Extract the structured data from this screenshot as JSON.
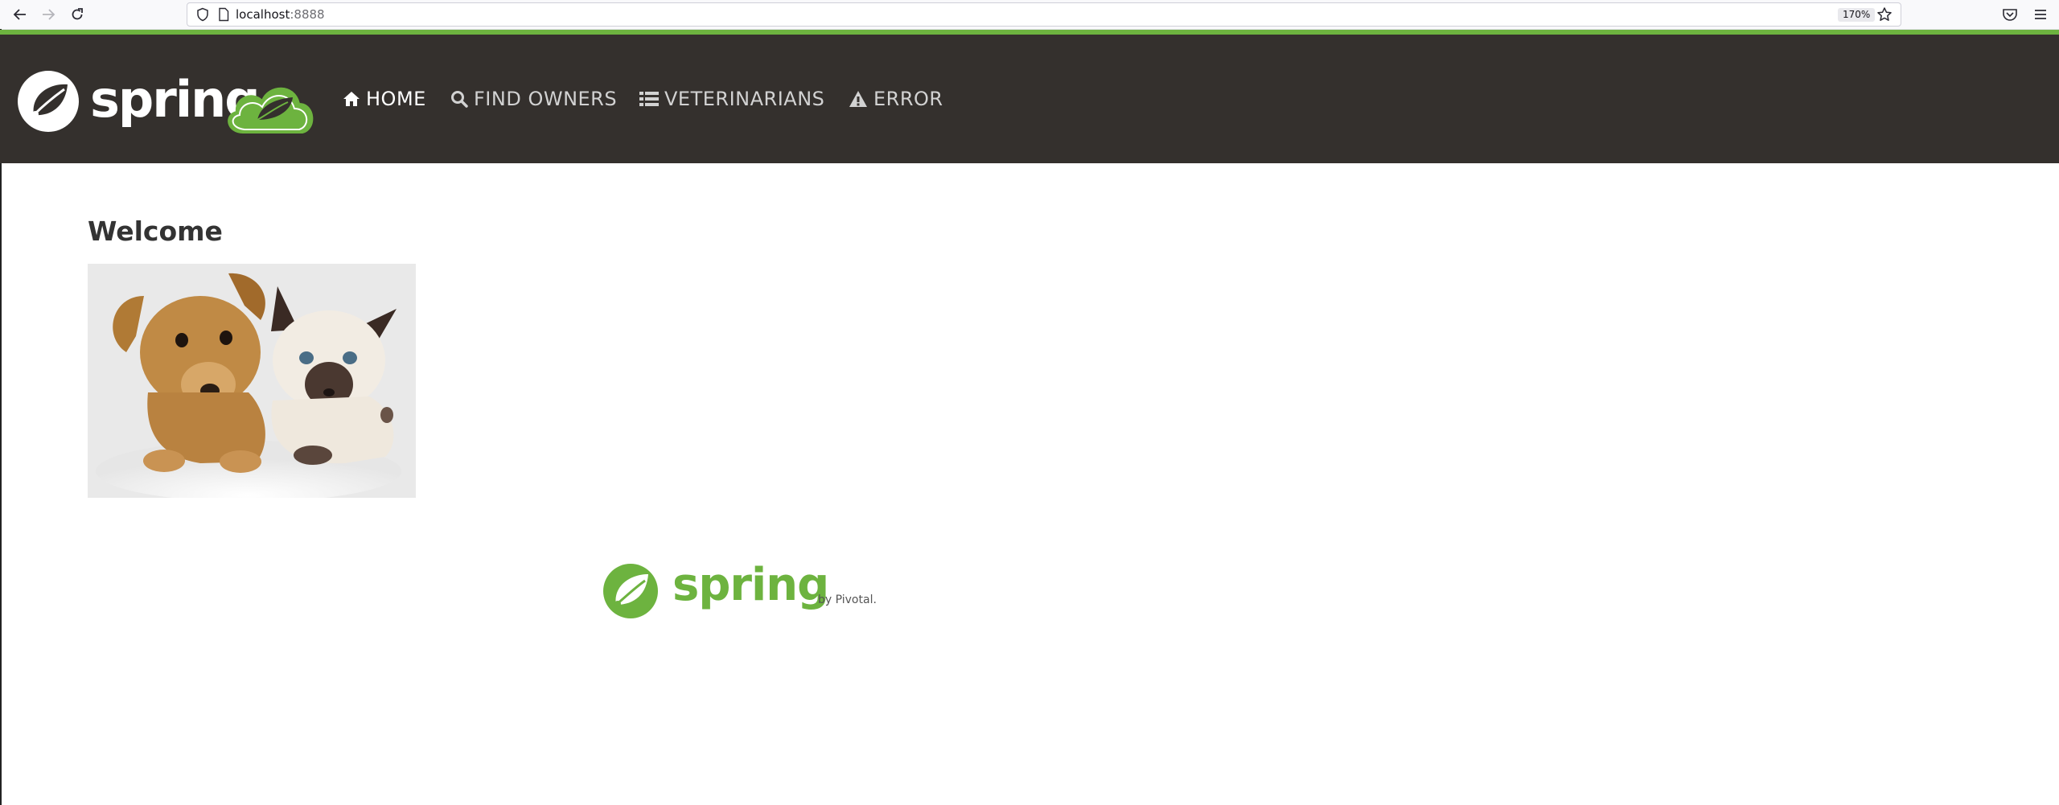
{
  "browser": {
    "url_host": "localhost",
    "url_port": ":8888",
    "zoom": "170%",
    "icons": [
      "back-arrow-icon",
      "forward-arrow-icon",
      "reload-icon",
      "shield-icon",
      "page-icon",
      "star-icon",
      "pocket-icon",
      "hamburger-menu-icon"
    ]
  },
  "brand": {
    "name": "spring",
    "colors": {
      "green": "#6db33f",
      "navbar": "#34302d",
      "accent_line": "#6db33f"
    }
  },
  "nav": {
    "items": [
      {
        "label": "HOME",
        "icon": "home-icon",
        "active": true
      },
      {
        "label": "FIND OWNERS",
        "icon": "search-icon",
        "active": false
      },
      {
        "label": "VETERINARIANS",
        "icon": "list-icon",
        "active": false
      },
      {
        "label": "ERROR",
        "icon": "warning-icon",
        "active": false
      }
    ]
  },
  "main": {
    "heading": "Welcome"
  },
  "footer": {
    "logo_text": "spring",
    "byline": "by Pivotal."
  }
}
